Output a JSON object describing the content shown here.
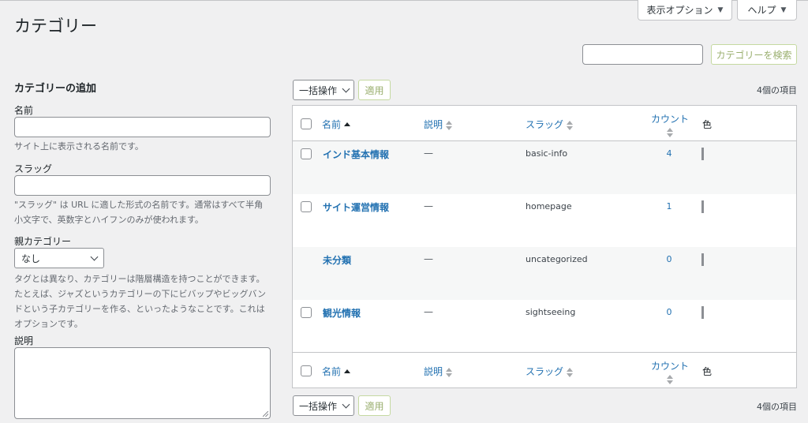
{
  "screen_meta": {
    "screen_options": "表示オプション",
    "help": "ヘルプ"
  },
  "page_title": "カテゴリー",
  "search": {
    "value": "",
    "button": "カテゴリーを検索"
  },
  "form": {
    "heading": "カテゴリーの追加",
    "name_label": "名前",
    "name_value": "",
    "name_desc": "サイト上に表示される名前です。",
    "slug_label": "スラッグ",
    "slug_value": "",
    "slug_desc_1": "\"スラッグ\" は URL に適した形式の名前です。通常はすべて半角",
    "slug_desc_2": "小文字で、英数字とハイフンのみが使われます。",
    "parent_label": "親カテゴリー",
    "parent_selected": "なし",
    "parent_desc_1": "タグとは異なり、カテゴリーは階層構造を持つことができます。",
    "parent_desc_2": "たとえば、ジャズというカテゴリーの下にビバップやビッグバン",
    "parent_desc_3": "ドという子カテゴリーを作る、といったようなことです。これは",
    "parent_desc_4": "オプションです。",
    "description_label": "説明",
    "description_value": ""
  },
  "bulk": {
    "selected": "一括操作",
    "apply": "適用",
    "items_count": "4個の項目"
  },
  "table": {
    "columns": {
      "name": "名前",
      "description": "説明",
      "slug": "スラッグ",
      "count": "カウント",
      "color": "色"
    },
    "rows": [
      {
        "name": "インド基本情報",
        "description": "—",
        "slug": "basic-info",
        "count": "4",
        "has_checkbox": true
      },
      {
        "name": "サイト運営情報",
        "description": "—",
        "slug": "homepage",
        "count": "1",
        "has_checkbox": true
      },
      {
        "name": "未分類",
        "description": "—",
        "slug": "uncategorized",
        "count": "0",
        "has_checkbox": false
      },
      {
        "name": "観光情報",
        "description": "—",
        "slug": "sightseeing",
        "count": "0",
        "has_checkbox": true
      }
    ]
  },
  "colors": {
    "link": "#2271b1",
    "apply_border": "#c5d9a1",
    "apply_text": "#9aaf6f"
  }
}
